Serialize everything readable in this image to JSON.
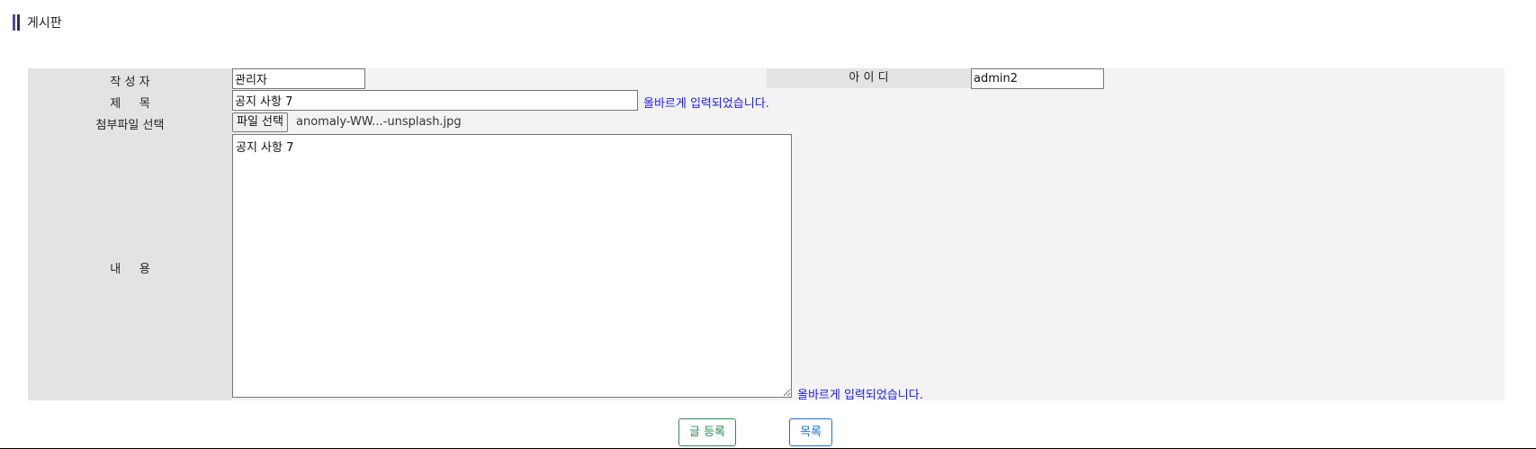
{
  "page": {
    "title": "게시판"
  },
  "form": {
    "author_label": "작 성 자",
    "author_value": "관리자",
    "id_label": "아 이 디",
    "id_value": "admin2",
    "subject_label": "제     목",
    "subject_value": "공지 사항 7",
    "subject_valid_msg": "올바르게 입력되었습니다.",
    "attach_label": "첨부파일 선택",
    "file_button_label": "파일 선택",
    "file_name": "anomaly-WW...-unsplash.jpg",
    "content_label": "내     용",
    "content_value": "공지 사항 7",
    "content_valid_msg": "올바르게 입력되었습니다."
  },
  "buttons": {
    "submit": "글 등록",
    "list": "목록"
  },
  "colors": {
    "valid_text": "#1a1aff",
    "submit_button": "#2e8b57",
    "list_button": "#1f6fd6",
    "label_bg": "#e3e3e3",
    "form_bg": "#f3f3f3"
  }
}
